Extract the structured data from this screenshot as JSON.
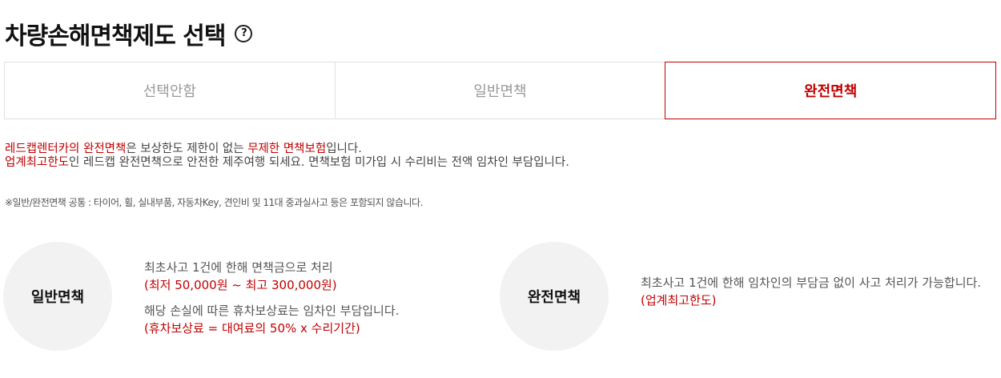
{
  "title": "차량손해면책제도 선택",
  "help_icon": "question-circle-icon",
  "options": [
    {
      "label": "선택안함",
      "selected": false
    },
    {
      "label": "일반면책",
      "selected": false
    },
    {
      "label": "완전면책",
      "selected": true
    }
  ],
  "description": {
    "line1_red1": "레드캡렌터카의 완전면책",
    "line1_text1": "은 보상한도 제한이 없는 ",
    "line1_red2": "무제한 면책보험",
    "line1_text2": "입니다.",
    "line2_red": "업계최고한도",
    "line2_text": "인 레드캡 완전면책으로 안전한 제주여행 되세요. 면책보험 미가입 시 수리비는 전액 임차인 부담입니다."
  },
  "note": "※일반/완전면책 공통 : 타이어, 휠, 실내부품, 자동차Key, 견인비 및 11대 중과실사고 등은 포함되지 않습니다.",
  "general": {
    "name": "일반면책",
    "line1": "최초사고 1건에 한해 면책금으로 처리",
    "line1_red": "(최저 50,000원 ~ 최고 300,000원)",
    "line2": "해당 손실에 따른 휴차보상료는 임차인 부담입니다.",
    "line2_red": "(휴차보상료 = 대여료의 50% x 수리기간)"
  },
  "full": {
    "name": "완전면책",
    "line1": "최초사고 1건에 한해 임차인의 부담금 없이 사고 처리가 가능합니다.",
    "line1_red": "(업계최고한도)"
  },
  "colors": {
    "accent": "#c00000",
    "circle_bg": "#f2f2f2",
    "border": "#e0e0e0"
  }
}
